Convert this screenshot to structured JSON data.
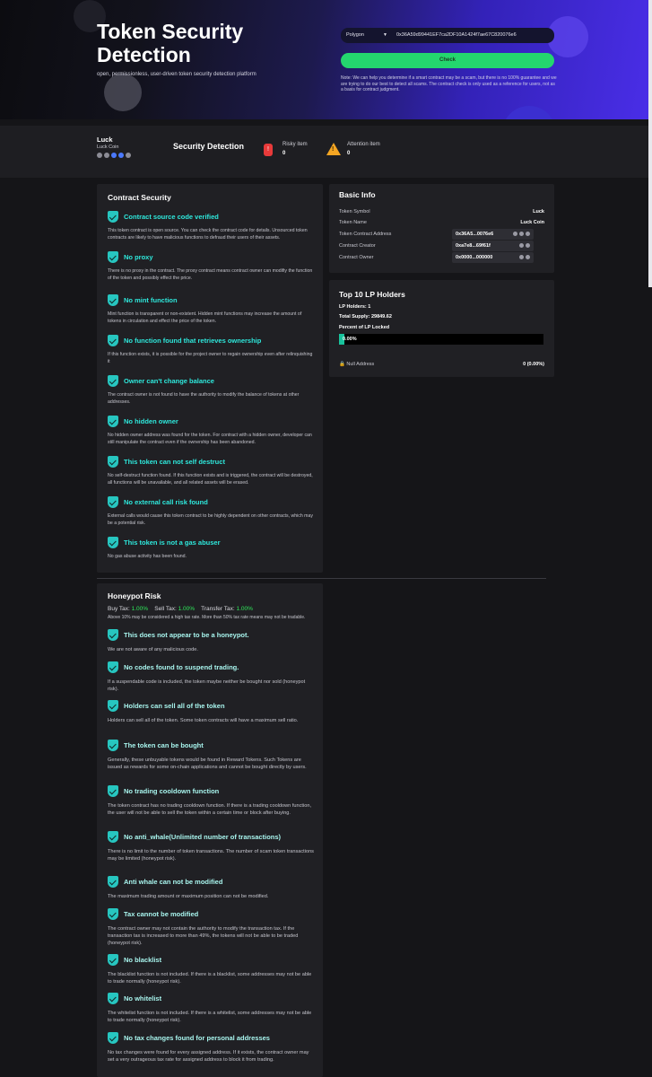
{
  "hero": {
    "title": "Token Security Detection",
    "subtitle": "open, permissionless, user-driven token security detection platform",
    "network": "Polygon",
    "address_value": "0x36A59d99441EF7ca2DF10A1424f7ae67C820076e6",
    "check_label": "Check",
    "note": "Note: We can help you determine if a smart contract may be a scam, but there is no 100% guarantee and we are trying to do our best to detect all scams. The contract check is only used as a reference for users, not as a basis for contract judgment."
  },
  "summary": {
    "token_symbol": "Luck",
    "token_name": "Luck Coin",
    "section_title": "Security Detection",
    "risky_label": "Risky item",
    "risky_count": "0",
    "attention_label": "Attention item",
    "attention_count": "0"
  },
  "contract_security": {
    "title": "Contract Security",
    "items": [
      {
        "title": "Contract source code verified",
        "desc": "This token contract is open source. You can check the contract code for details. Unsourced token contracts are likely to have malicious functions to defraud their users of their assets."
      },
      {
        "title": "No proxy",
        "desc": "There is no proxy in the contract. The proxy contract means contract owner can modifiy the function of the token and possibly effect the price."
      },
      {
        "title": "No mint function",
        "desc": "Mint function is transparent or non-existent. Hidden mint functions may increase the amount of tokens in circulation and effect the price of the token."
      },
      {
        "title": "No function found that retrieves ownership",
        "desc": "If this function exists, it is possible for the project owner to regain ownership even after relinquishing it"
      },
      {
        "title": "Owner can't change balance",
        "desc": "The contract owner is not found to have the authority to modify the balance of tokens at other addresses."
      },
      {
        "title": "No hidden owner",
        "desc": "No hidden owner address was found for the token. For contract with a hidden owner, developer can still manipulate the contract even if the ownership has been abandoned."
      },
      {
        "title": "This token can not self destruct",
        "desc": "No self-destruct function found. If this function exists and is triggered, the contract will be destroyed, all functions will be unavailable, and all related assets will be erased."
      },
      {
        "title": "No external call risk found",
        "desc": "External calls would cause this token contract to be highly dependent on other contracts, which may be a potential risk."
      },
      {
        "title": "This token is not a gas abuser",
        "desc": "No gas abuse activity has been found."
      }
    ]
  },
  "basic_info": {
    "title": "Basic Info",
    "rows": [
      {
        "label": "Token Symbol",
        "value": "Luck"
      },
      {
        "label": "Token Name",
        "value": "Luck Coin"
      },
      {
        "label": "Token Contract Address",
        "value": "0x36A5...0076e6"
      },
      {
        "label": "Contract Creator",
        "value": "0xa7e8...69f61f"
      },
      {
        "label": "Contract Owner",
        "value": "0x0000...000000"
      }
    ]
  },
  "lp_holders": {
    "title": "Top 10 LP Holders",
    "lp_holders": "LP Holders: 1",
    "total_supply": "Total Supply: 29849.62",
    "percent_label": "Percent of LP Locked",
    "percent_value": "0.00%",
    "percent_fraction": 0.0,
    "null_address": "Null Address",
    "null_value": "0  (0.00%)"
  },
  "honeypot": {
    "title": "Honeypot Risk",
    "buy_tax_label": "Buy Tax:",
    "buy_tax": "1.00%",
    "sell_tax_label": "Sell Tax:",
    "sell_tax": "1.00%",
    "transfer_tax_label": "Transfer Tax:",
    "transfer_tax": "1.00%",
    "tax_note": "Above 10% may be considered a high tax rate. More than 50% tax rate means may not be tradable.",
    "items": [
      {
        "title": "This does not appear to be a honeypot.",
        "desc": "We are not aware of any malicious code."
      },
      {
        "title": "No codes found to suspend trading.",
        "desc": "If a suspendable code is included, the token maybe neither be bought nor sold (honeypot risk)."
      },
      {
        "title": "Holders can sell all of the token",
        "desc": "Holders can sell all of the token. Some token contracts will have a maximum sell ratio."
      },
      {
        "title": "The token can be bought",
        "desc": "Generally, these unbuyable tokens would be found in Reward Tokens. Such Tokens are issued as rewards for some on-chain applications and cannot be bought directly by users."
      },
      {
        "title": "No trading cooldown function",
        "desc": "The token contract has no trading cooldown function. If there is a trading cooldown function, the user will not be able to sell the token within a certain time or block after buying."
      },
      {
        "title": "No anti_whale(Unlimited number of transactions)",
        "desc": "There is no limit to the number of token transactions. The number of scam token transactions may be limited (honeypot risk)."
      },
      {
        "title": "Anti whale can not be modified",
        "desc": "The maximum trading amount or maximum position can not be modified."
      },
      {
        "title": "Tax cannot be modified",
        "desc": "The contract owner may not contain the authority to modify the transaction tax. If the transaction tax is increased to more than 49%, the tokens will not be able to be traded (honeypot risk)."
      },
      {
        "title": "No blacklist",
        "desc": "The blacklist function is not included. If there is a blacklist, some addresses may not be able to trade normally (honeypot risk)."
      },
      {
        "title": "No whitelist",
        "desc": "The whitelist function is not included. If there is a whitelist, some addresses may not be able to trade normally (honeypot risk)."
      },
      {
        "title": "No tax changes found for personal addresses",
        "desc": "No tax changes were found for every assigned address. If it exists, the contract owner may set a very outrageous tax rate for assigned address to block it from trading."
      }
    ]
  }
}
